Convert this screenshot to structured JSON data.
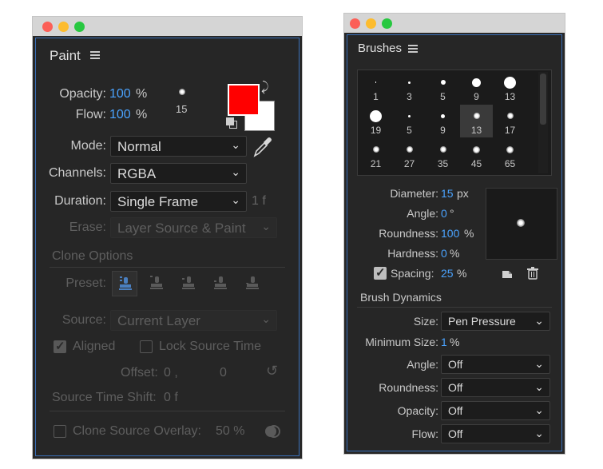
{
  "paint": {
    "title": "Paint",
    "opacity_label": "Opacity:",
    "opacity_value": "100",
    "opacity_unit": "%",
    "flow_label": "Flow:",
    "flow_value": "100",
    "flow_unit": "%",
    "brush_size": "15",
    "foreground_color": "#ff0000",
    "background_color": "#ffffff",
    "mode_label": "Mode:",
    "mode_value": "Normal",
    "channels_label": "Channels:",
    "channels_value": "RGBA",
    "duration_label": "Duration:",
    "duration_value": "Single Frame",
    "duration_frames": "1 f",
    "erase_label": "Erase:",
    "erase_value": "Layer Source & Paint",
    "clone_options_title": "Clone Options",
    "preset_label": "Preset:",
    "source_label": "Source:",
    "source_value": "Current Layer",
    "aligned_label": "Aligned",
    "lock_source_time_label": "Lock Source Time",
    "offset_label": "Offset:",
    "offset_x": "0 ,",
    "offset_y": "0",
    "source_time_shift_label": "Source Time Shift:",
    "source_time_shift_value": "0 f",
    "clone_source_overlay_label": "Clone Source Overlay:",
    "clone_source_overlay_value": "50 %"
  },
  "brushes": {
    "title": "Brushes",
    "tips": [
      {
        "size": "1",
        "dot": 1.5
      },
      {
        "size": "3",
        "dot": 3
      },
      {
        "size": "5",
        "dot": 6
      },
      {
        "size": "9",
        "dot": 11
      },
      {
        "size": "13",
        "dot": 15
      },
      {
        "size": "19",
        "dot": 15
      },
      {
        "size": "5",
        "dot": 3
      },
      {
        "size": "9",
        "dot": 5
      },
      {
        "size": "13",
        "dot": 8,
        "selected": true
      },
      {
        "size": "17",
        "dot": 8
      },
      {
        "size": "21",
        "dot": 8
      },
      {
        "size": "27",
        "dot": 8
      },
      {
        "size": "35",
        "dot": 8
      },
      {
        "size": "45",
        "dot": 9
      },
      {
        "size": "65",
        "dot": 9
      }
    ],
    "diameter_label": "Diameter:",
    "diameter_value": "15",
    "diameter_unit": "px",
    "angle_label": "Angle:",
    "angle_value": "0",
    "angle_unit": "°",
    "roundness_label": "Roundness:",
    "roundness_value": "100",
    "roundness_unit": "%",
    "hardness_label": "Hardness:",
    "hardness_value": "0",
    "hardness_unit": "%",
    "spacing_label": "Spacing:",
    "spacing_value": "25",
    "spacing_unit": "%",
    "dynamics_title": "Brush Dynamics",
    "size_label": "Size:",
    "size_value": "Pen Pressure",
    "min_size_label": "Minimum Size:",
    "min_size_value": "1",
    "min_size_unit": "%",
    "dyn_angle_label": "Angle:",
    "dyn_angle_value": "Off",
    "dyn_roundness_label": "Roundness:",
    "dyn_roundness_value": "Off",
    "dyn_opacity_label": "Opacity:",
    "dyn_opacity_value": "Off",
    "dyn_flow_label": "Flow:",
    "dyn_flow_value": "Off"
  }
}
